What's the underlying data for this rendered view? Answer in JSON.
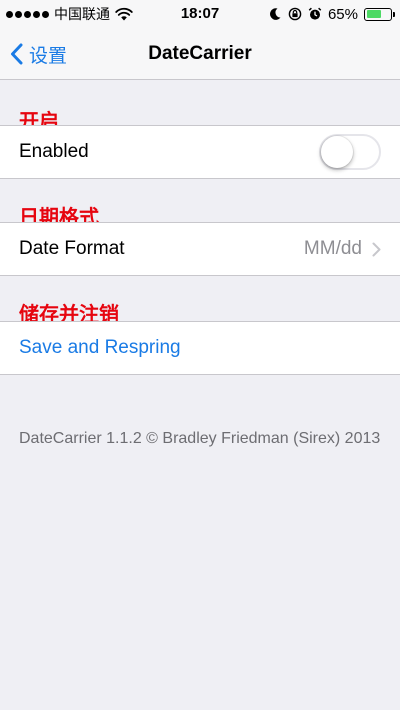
{
  "status_bar": {
    "carrier": "中国联通",
    "time": "18:07",
    "battery_percent": "65%",
    "battery_level": 0.65,
    "icons": [
      "signal-dots-icon",
      "wifi-icon",
      "moon-icon",
      "rotation-lock-icon",
      "alarm-icon",
      "battery-icon"
    ]
  },
  "nav": {
    "back_label": "设置",
    "title": "DateCarrier"
  },
  "sections": {
    "enable": {
      "header": "开启",
      "label": "Enabled",
      "toggle_on": false
    },
    "date_format": {
      "header": "日期格式",
      "label": "Date Format",
      "value": "MM/dd"
    },
    "save": {
      "header": "储存并注销",
      "label": "Save and Respring"
    }
  },
  "footer": {
    "text": "DateCarrier 1.1.2 © Bradley Friedman (Sirex) 2013"
  },
  "colors": {
    "background": "#efeff4",
    "accent_blue": "#1a7be5",
    "header_red": "#e6050f",
    "battery_green": "#4cd964"
  }
}
